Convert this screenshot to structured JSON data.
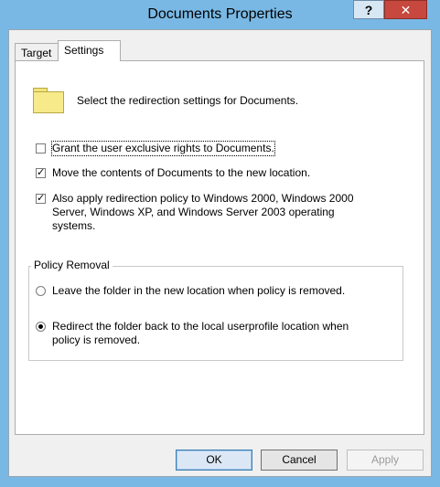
{
  "window": {
    "title": "Documents Properties",
    "help_label": "?",
    "close_label": "✕"
  },
  "tabs": [
    {
      "label": "Target",
      "selected": false
    },
    {
      "label": "Settings",
      "selected": true
    }
  ],
  "settings": {
    "intro": "Select the redirection settings for Documents.",
    "options": [
      {
        "label": "Grant the user exclusive rights to Documents.",
        "checked": false,
        "mnemonic": "G"
      },
      {
        "label": "Move the contents of Documents to the new location.",
        "checked": true,
        "mnemonic": "M"
      },
      {
        "line1": "Also apply redirection policy to Windows 2000, Windows 2000",
        "line2": "Server, Windows XP, and Windows Server 2003 operating",
        "line3": "systems.",
        "checked": true,
        "mnemonic": "A"
      }
    ]
  },
  "policy_removal": {
    "title": "Policy Removal",
    "options": [
      {
        "label": "Leave the folder in the new location when policy is removed.",
        "selected": false
      },
      {
        "line1": "Redirect the folder back to the local userprofile location when",
        "line2": "policy is removed.",
        "selected": true
      }
    ]
  },
  "buttons": {
    "ok": "OK",
    "cancel": "Cancel",
    "apply": "Apply"
  },
  "colors": {
    "frame": "#79b8e4",
    "close": "#c7483e"
  },
  "icons": {
    "folder": "folder-icon",
    "check": "checkmark-icon"
  }
}
